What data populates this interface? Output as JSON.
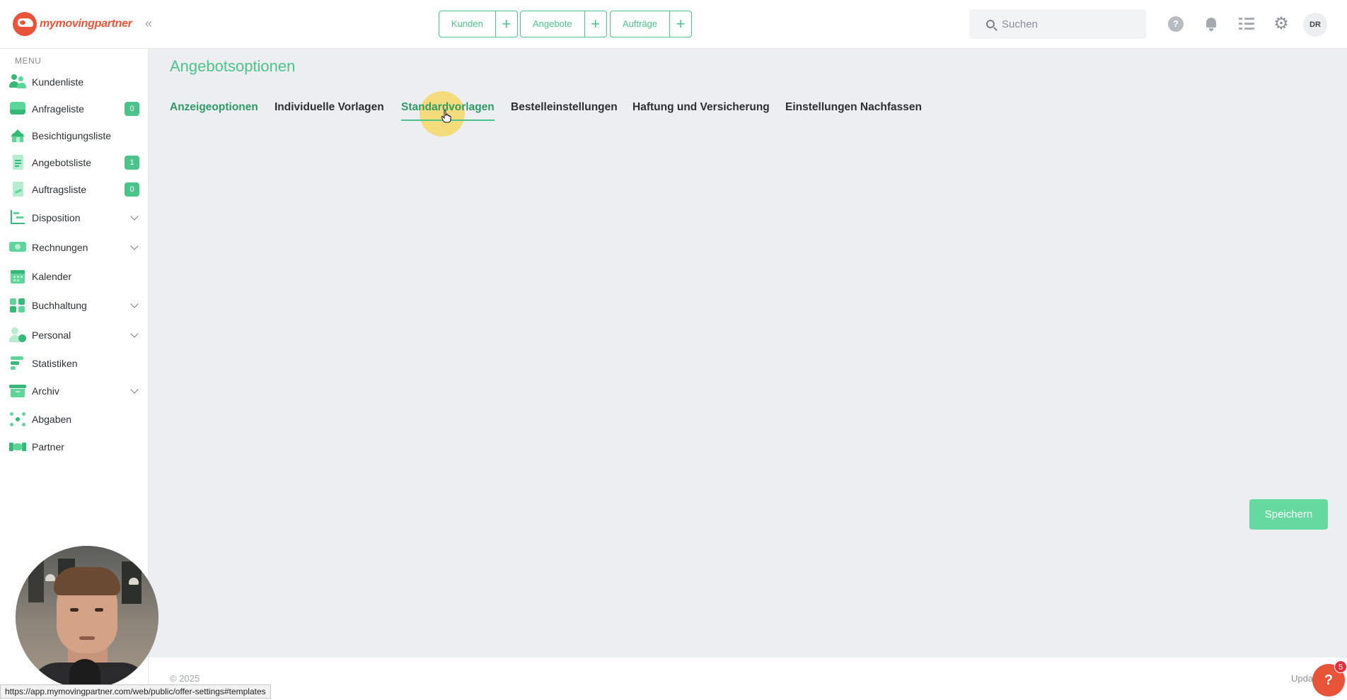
{
  "app": {
    "logo": "mymovingpartner",
    "logo_parts": {
      "my": "my",
      "moving": "moving",
      "partner": "partner"
    }
  },
  "header": {
    "quick_actions": [
      {
        "label": "Kunden"
      },
      {
        "label": "Angebote"
      },
      {
        "label": "Aufträge"
      }
    ],
    "plus_glyph": "+",
    "search_placeholder": "Suchen",
    "help_glyph": "?",
    "avatar_initials": "DR"
  },
  "sidebar": {
    "caption": "MENU",
    "items": [
      {
        "label": "Kundenliste",
        "icon": "users-icon"
      },
      {
        "label": "Anfrageliste",
        "icon": "inbox-icon",
        "badge": "0"
      },
      {
        "label": "Besichtigungsliste",
        "icon": "house-icon"
      },
      {
        "label": "Angebotsliste",
        "icon": "document-icon",
        "badge": "1"
      },
      {
        "label": "Auftragsliste",
        "icon": "contract-icon",
        "badge": "0"
      },
      {
        "label": "Disposition",
        "icon": "gantt-icon",
        "expandable": true
      },
      {
        "label": "Rechnungen",
        "icon": "money-icon",
        "expandable": true
      },
      {
        "label": "Kalender",
        "icon": "calendar-icon"
      },
      {
        "label": "Buchhaltung",
        "icon": "ledger-icon",
        "expandable": true
      },
      {
        "label": "Personal",
        "icon": "staff-icon",
        "expandable": true
      },
      {
        "label": "Statistiken",
        "icon": "stats-icon"
      },
      {
        "label": "Archiv",
        "icon": "archive-icon",
        "expandable": true
      },
      {
        "label": "Abgaben",
        "icon": "network-icon"
      },
      {
        "label": "Partner",
        "icon": "handshake-icon"
      }
    ]
  },
  "main": {
    "title": "Angebotsoptionen",
    "tabs": [
      {
        "label": "Anzeigeoptionen"
      },
      {
        "label": "Individuelle Vorlagen"
      },
      {
        "label": "Standardvorlagen",
        "active": true
      },
      {
        "label": "Bestelleinstellungen"
      },
      {
        "label": "Haftung und Versicherung"
      },
      {
        "label": "Einstellungen Nachfassen"
      }
    ],
    "save_label": "Speichern"
  },
  "footer": {
    "copyright": "© 2025",
    "update_text": "Upda",
    "help_badge": "5",
    "help_glyph": "?"
  },
  "status_url": "https://app.mymovingpartner.com/web/public/offer-settings#templates",
  "colors": {
    "accent": "#4cc38a",
    "accent_dark": "#2f9a66",
    "brand": "#e8543a",
    "background": "#eceef2"
  }
}
